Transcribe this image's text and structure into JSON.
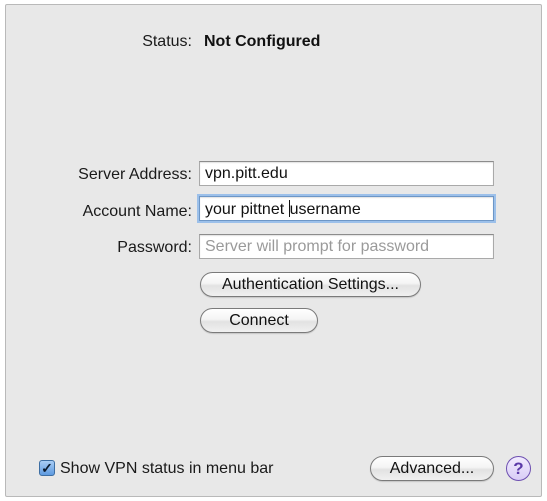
{
  "status": {
    "label": "Status:",
    "value": "Not Configured"
  },
  "form": {
    "server_address_label": "Server Address:",
    "server_address_value": "vpn.pitt.edu",
    "account_name_label": "Account Name:",
    "account_name_value_before_caret": "your pittnet ",
    "account_name_value_after_caret": "username",
    "password_label": "Password:",
    "password_placeholder": "Server will prompt for password"
  },
  "buttons": {
    "authentication_settings": "Authentication Settings...",
    "connect": "Connect",
    "advanced": "Advanced...",
    "help": "?"
  },
  "footer": {
    "show_vpn_status_label": "Show VPN status in menu bar",
    "show_vpn_status_checked": true,
    "checkmark": "✓"
  }
}
